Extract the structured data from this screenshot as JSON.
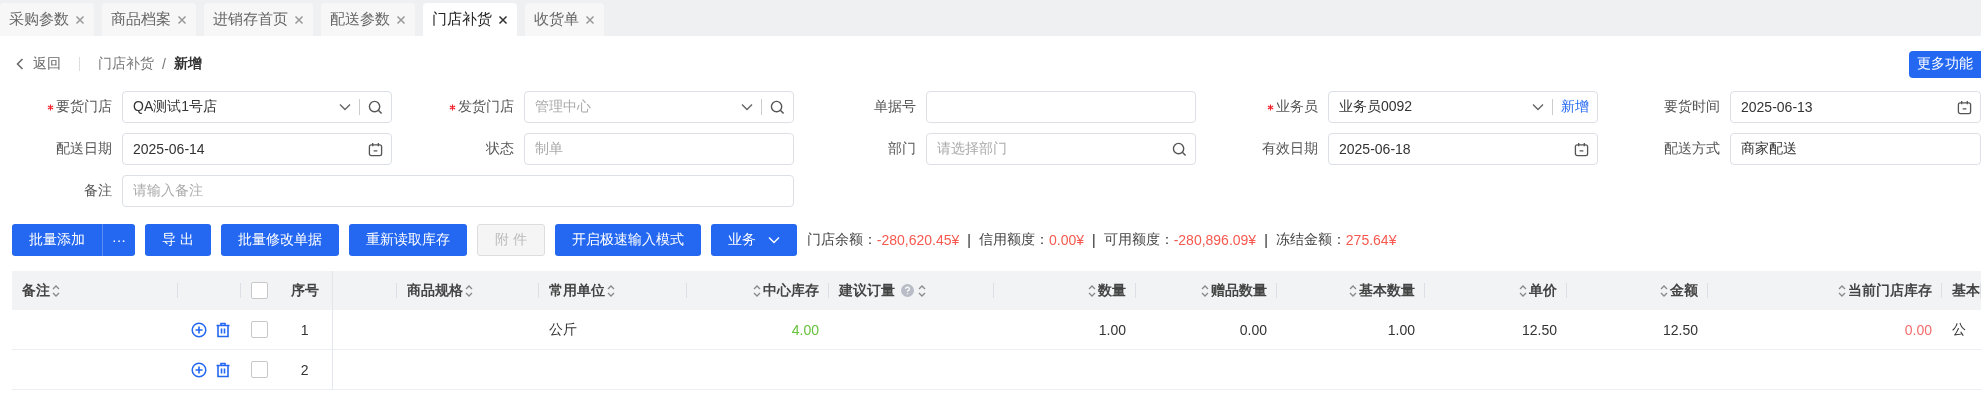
{
  "tabs": [
    {
      "label": "采购参数",
      "selected": false
    },
    {
      "label": "商品档案",
      "selected": false
    },
    {
      "label": "进销存首页",
      "selected": false
    },
    {
      "label": "配送参数",
      "selected": false
    },
    {
      "label": "门店补货",
      "selected": true
    },
    {
      "label": "收货单",
      "selected": false
    }
  ],
  "breadcrumb": {
    "back": "返回",
    "trail": [
      {
        "kind": "link",
        "text": "门店补货"
      },
      {
        "kind": "separator",
        "text": "/"
      },
      {
        "kind": "current",
        "text": "新增"
      }
    ]
  },
  "more_button": "更多功能",
  "form": {
    "fields": [
      {
        "label": "要货门店",
        "required": true,
        "kind": "select-search",
        "value": "QA测试1号店"
      },
      {
        "label": "发货门店",
        "required": true,
        "kind": "select-search",
        "placeholder": "管理中心"
      },
      {
        "label": "单据号",
        "required": false,
        "kind": "input"
      },
      {
        "label": "业务员",
        "required": true,
        "kind": "select-add",
        "value": "业务员0092",
        "action": "新增"
      },
      {
        "label": "要货时间",
        "required": false,
        "kind": "date",
        "value": "2025-06-13"
      },
      {
        "label": "配送日期",
        "required": false,
        "kind": "date",
        "value": "2025-06-14"
      },
      {
        "label": "状态",
        "required": false,
        "kind": "input",
        "placeholder": "制单"
      },
      {
        "label": "部门",
        "required": false,
        "kind": "search",
        "placeholder": "请选择部门"
      },
      {
        "label": "有效日期",
        "required": false,
        "kind": "date",
        "value": "2025-06-18"
      },
      {
        "label": "配送方式",
        "required": false,
        "kind": "input",
        "value": "商家配送"
      },
      {
        "label": "备注",
        "required": false,
        "kind": "wide",
        "placeholder": "请输入备注"
      }
    ]
  },
  "toolbar": {
    "buttons": [
      {
        "label": "批量添加",
        "kind": "split",
        "more": "···",
        "disabled": false
      },
      {
        "label": "导 出",
        "kind": "plain",
        "disabled": false
      },
      {
        "label": "批量修改单据",
        "kind": "plain",
        "disabled": false
      },
      {
        "label": "重新读取库存",
        "kind": "plain",
        "disabled": false
      },
      {
        "label": "附 件",
        "kind": "plain",
        "disabled": true
      },
      {
        "label": "开启极速输入模式",
        "kind": "plain",
        "disabled": false
      },
      {
        "label": "业务",
        "kind": "dropdown",
        "disabled": false
      }
    ],
    "balances": [
      {
        "kind": "amount",
        "label": "门店余额：",
        "value": "-280,620.45¥"
      },
      {
        "kind": "separator",
        "text": "|"
      },
      {
        "kind": "amount",
        "label": "信用额度：",
        "value": "0.00¥"
      },
      {
        "kind": "separator",
        "text": "|"
      },
      {
        "kind": "amount",
        "label": "可用额度：",
        "value": "-280,896.09¥"
      },
      {
        "kind": "separator",
        "text": "|"
      },
      {
        "kind": "amount",
        "label": "冻结金额：",
        "value": "275.64¥"
      }
    ]
  },
  "table": {
    "columns": [
      {
        "kind": "data",
        "label": "备注",
        "sortable": true
      },
      {
        "kind": "actions"
      },
      {
        "kind": "check",
        "checked": false
      },
      {
        "kind": "index",
        "label": "序号"
      },
      {
        "kind": "blank"
      },
      {
        "kind": "data",
        "label": "商品规格",
        "sortable": true
      },
      {
        "kind": "data",
        "label": "常用单位",
        "sortable": true
      },
      {
        "kind": "data",
        "label": "中心库存",
        "sortable": true
      },
      {
        "kind": "data",
        "label": "建议订量",
        "sortable": true,
        "help": true
      },
      {
        "kind": "data",
        "label": "数量",
        "sortable": true
      },
      {
        "kind": "data",
        "label": "赠品数量",
        "sortable": true
      },
      {
        "kind": "data",
        "label": "基本数量",
        "sortable": true
      },
      {
        "kind": "data",
        "label": "单价",
        "sortable": true
      },
      {
        "kind": "data",
        "label": "金额",
        "sortable": true
      },
      {
        "kind": "data",
        "label": "当前门店库存",
        "sortable": true
      },
      {
        "kind": "data",
        "label": "基本"
      }
    ],
    "rows": [
      {
        "index": "1",
        "checked": false,
        "cells": [
          null,
          null,
          {
            "text": "公斤"
          },
          {
            "text": "4.00",
            "color": "#67c23a"
          },
          null,
          {
            "text": "1.00"
          },
          {
            "text": "0.00"
          },
          {
            "text": "1.00"
          },
          {
            "text": "12.50"
          },
          {
            "text": "12.50"
          },
          {
            "text": "0.00",
            "color": "#f56c6c"
          },
          {
            "text": "公"
          }
        ]
      },
      {
        "index": "2",
        "checked": false
      }
    ]
  }
}
